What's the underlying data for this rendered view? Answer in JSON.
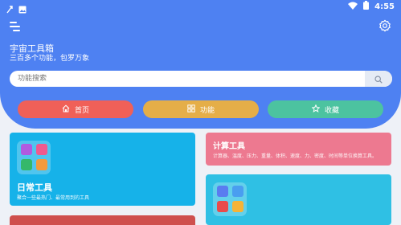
{
  "status_bar": {
    "time": "4:55",
    "left_icons": [
      "notification-icon",
      "image-icon"
    ],
    "right_icons": [
      "wifi-icon",
      "battery-icon"
    ]
  },
  "header": {
    "title": "宇宙工具箱",
    "subtitle": "三百多个功能，包罗万象",
    "menu_icon": "menu-icon",
    "settings_icon": "gear-icon"
  },
  "search": {
    "placeholder": "功能搜索",
    "value": "",
    "icon": "search-icon"
  },
  "nav": [
    {
      "label": "首页",
      "icon": "home-icon",
      "color": "#f06058"
    },
    {
      "label": "功能",
      "icon": "grid-icon",
      "color": "#e5ae48"
    },
    {
      "label": "收藏",
      "icon": "star-icon",
      "color": "#4cc3a0"
    }
  ],
  "cards": {
    "daily": {
      "title": "日常工具",
      "description": "聚合一些最热门、最常用到的工具",
      "color": "#16b2e9"
    },
    "calc": {
      "title": "计算工具",
      "description": "计算器、温度、压力、重量、体积、速度、力、密度、时间等单位换算工具。",
      "color": "#ed7990"
    },
    "teal": {
      "color": "#2fc0e4"
    },
    "red": {
      "color": "#cf4f4d"
    }
  },
  "colors": {
    "header_bg": "#4e81f2",
    "page_bg": "#eef1f7"
  }
}
